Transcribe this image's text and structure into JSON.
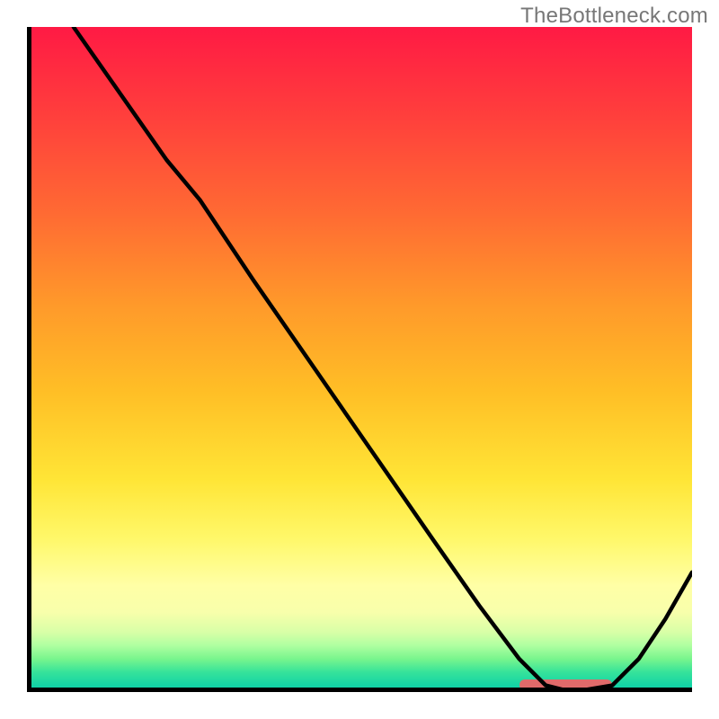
{
  "watermark": "TheBottleneck.com",
  "chart_data": {
    "type": "line",
    "title": "",
    "xlabel": "",
    "ylabel": "",
    "xlim": [
      0,
      100
    ],
    "ylim": [
      0,
      100
    ],
    "background": {
      "style": "vertical-gradient",
      "stops": [
        {
          "pos": 0,
          "color": "#ff1a44"
        },
        {
          "pos": 12,
          "color": "#ff3b3d"
        },
        {
          "pos": 28,
          "color": "#ff6a33"
        },
        {
          "pos": 42,
          "color": "#ff9a2a"
        },
        {
          "pos": 55,
          "color": "#ffbf26"
        },
        {
          "pos": 68,
          "color": "#ffe536"
        },
        {
          "pos": 77,
          "color": "#fff86a"
        },
        {
          "pos": 84,
          "color": "#ffffa6"
        },
        {
          "pos": 88,
          "color": "#f8ffab"
        },
        {
          "pos": 91,
          "color": "#d8ffa7"
        },
        {
          "pos": 93,
          "color": "#afffa1"
        },
        {
          "pos": 95,
          "color": "#79f58d"
        },
        {
          "pos": 97,
          "color": "#36e39a"
        },
        {
          "pos": 99,
          "color": "#14d4a6"
        },
        {
          "pos": 100,
          "color": "#0bcfa8"
        }
      ]
    },
    "series": [
      {
        "name": "bottleneck-curve",
        "x": [
          7,
          14,
          21,
          26,
          34,
          43,
          52,
          61,
          68,
          74,
          78,
          82,
          88,
          92,
          96,
          100
        ],
        "y": [
          100,
          90,
          80,
          74,
          62,
          49,
          36,
          23,
          13,
          5,
          1,
          0,
          1,
          5,
          11,
          18
        ]
      }
    ],
    "annotations": [
      {
        "name": "optimal-range-marker",
        "type": "hband",
        "x_start": 74,
        "x_end": 88,
        "y": 1.5,
        "color": "#e06a6a"
      }
    ],
    "grid": false,
    "legend": false
  }
}
